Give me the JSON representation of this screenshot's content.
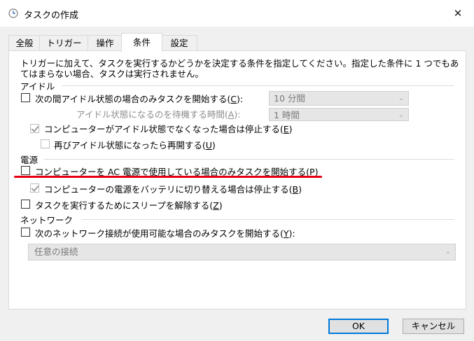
{
  "window": {
    "title": "タスクの作成",
    "close_glyph": "✕"
  },
  "tabs": [
    {
      "label": "全般"
    },
    {
      "label": "トリガー"
    },
    {
      "label": "操作"
    },
    {
      "label": "条件",
      "active": true
    },
    {
      "label": "設定"
    }
  ],
  "conditions": {
    "description": "トリガーに加えて、タスクを実行するかどうかを決定する条件を指定してください。指定した条件に 1 つでもあてはまらない場合、タスクは実行されません。",
    "idle": {
      "section_label": "アイドル",
      "start_if_idle": {
        "label_pre": "次の間アイドル状態の場合のみタスクを開始する(",
        "key": "C",
        "label_post": "):",
        "checked": false
      },
      "idle_duration": {
        "value": "10 分間"
      },
      "wait_label": {
        "label_pre": "アイドル状態になるのを待機する時間(",
        "key": "A",
        "label_post": "):"
      },
      "wait_duration": {
        "value": "1 時間"
      },
      "stop_if_not_idle": {
        "label_pre": "コンピューターがアイドル状態でなくなった場合は停止する(",
        "key": "E",
        "label_post": ")",
        "checked": true
      },
      "restart_if_idle": {
        "label_pre": "再びアイドル状態になったら再開する(",
        "key": "U",
        "label_post": ")",
        "checked": false
      }
    },
    "power": {
      "section_label": "電源",
      "ac_only": {
        "label_pre": "コンピューターを AC 電源で使用している場合のみタスクを開始する(",
        "key": "P",
        "label_post": ")",
        "checked": false
      },
      "stop_on_battery": {
        "label_pre": "コンピューターの電源をバッテリに切り替える場合は停止する(",
        "key": "B",
        "label_post": ")",
        "checked": true
      },
      "wake": {
        "label_pre": "タスクを実行するためにスリープを解除する(",
        "key": "Z",
        "label_post": ")",
        "checked": false
      }
    },
    "network": {
      "section_label": "ネットワーク",
      "only_if_network": {
        "label_pre": "次のネットワーク接続が使用可能な場合のみタスクを開始する(",
        "key": "Y",
        "label_post": "):",
        "checked": false
      },
      "connection": {
        "value": "任意の接続"
      }
    }
  },
  "buttons": {
    "ok": "OK",
    "cancel": "キャンセル"
  },
  "colors": {
    "annotation": "#e60012",
    "accent": "#0078d7"
  }
}
